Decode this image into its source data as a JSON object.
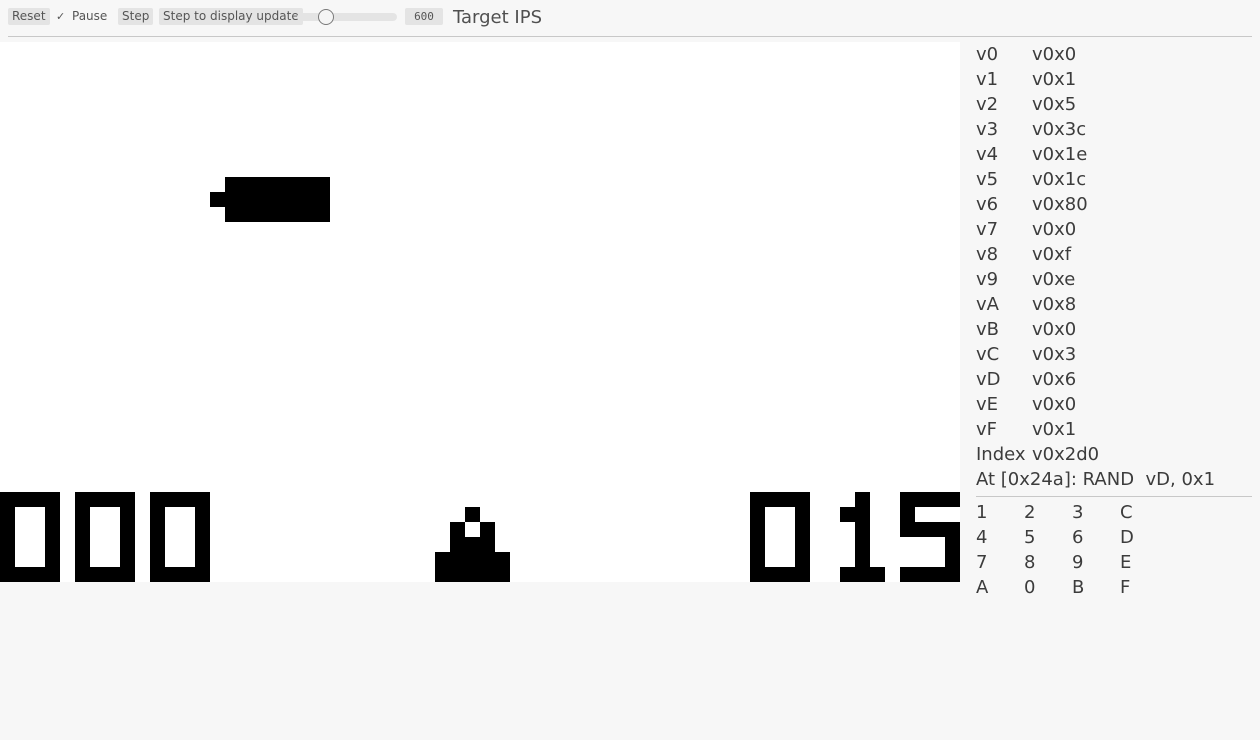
{
  "toolbar": {
    "reset_label": "Reset",
    "pause_label": "Pause",
    "pause_checked": true,
    "check_mark": "✓",
    "step_label": "Step",
    "step_display_label": "Step to display update",
    "ips_value": "600",
    "ips_fraction": 0.24,
    "target_ips_label": "Target IPS"
  },
  "display": {
    "background": "#ffffff",
    "pixel_color": "#000000"
  },
  "registers": [
    {
      "name": "v0",
      "value": "v0x0"
    },
    {
      "name": "v1",
      "value": "v0x1"
    },
    {
      "name": "v2",
      "value": "v0x5"
    },
    {
      "name": "v3",
      "value": "v0x3c"
    },
    {
      "name": "v4",
      "value": "v0x1e"
    },
    {
      "name": "v5",
      "value": "v0x1c"
    },
    {
      "name": "v6",
      "value": "v0x80"
    },
    {
      "name": "v7",
      "value": "v0x0"
    },
    {
      "name": "v8",
      "value": "v0xf"
    },
    {
      "name": "v9",
      "value": "v0xe"
    },
    {
      "name": "vA",
      "value": "v0x8"
    },
    {
      "name": "vB",
      "value": "v0x0"
    },
    {
      "name": "vC",
      "value": "v0x3"
    },
    {
      "name": "vD",
      "value": "v0x6"
    },
    {
      "name": "vE",
      "value": "v0x0"
    },
    {
      "name": "vF",
      "value": "v0x1"
    },
    {
      "name": "Index",
      "value": "v0x2d0"
    }
  ],
  "current_instruction": "At [0x24a]: RAND  vD, 0x1",
  "keypad": [
    [
      "1",
      "2",
      "3",
      "C"
    ],
    [
      "4",
      "5",
      "6",
      "D"
    ],
    [
      "7",
      "8",
      "9",
      "E"
    ],
    [
      "A",
      "0",
      "B",
      "F"
    ]
  ]
}
